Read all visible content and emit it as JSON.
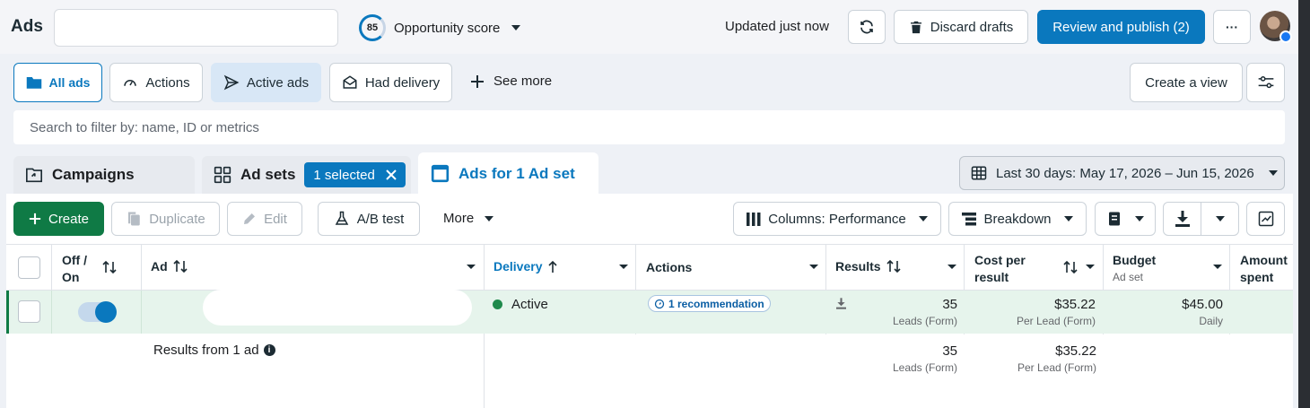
{
  "header": {
    "title": "Ads",
    "search_value": "",
    "score_value": "85",
    "score_label": "Opportunity score",
    "updated_text": "Updated just now",
    "discard_label": "Discard drafts",
    "publish_label": "Review and publish (2)",
    "more_glyph": "···"
  },
  "view_tabs": {
    "all_ads": "All ads",
    "actions": "Actions",
    "active_ads": "Active ads",
    "had_delivery": "Had delivery",
    "see_more": "See more",
    "create_view": "Create a view"
  },
  "filter": {
    "placeholder": "Search to filter by: name, ID or metrics"
  },
  "level_tabs": {
    "campaigns": "Campaigns",
    "ad_sets": "Ad sets",
    "selected_badge": "1 selected",
    "ads_for": "Ads for 1 Ad set"
  },
  "date_range": "Last 30 days: May 17, 2026 – Jun 15, 2026",
  "toolbar": {
    "create": "Create",
    "duplicate": "Duplicate",
    "edit": "Edit",
    "ab_test": "A/B test",
    "more": "More",
    "columns": "Columns: Performance",
    "breakdown": "Breakdown"
  },
  "table": {
    "headers": {
      "offon_1": "Off /",
      "offon_2": "On",
      "ad": "Ad",
      "delivery": "Delivery",
      "actions": "Actions",
      "results": "Results",
      "cost_1": "Cost per",
      "cost_2": "result",
      "budget": "Budget",
      "budget_sub": "Ad set",
      "amount_1": "Amount",
      "amount_2": "spent"
    },
    "row": {
      "delivery": "Active",
      "recommendation": "1 recommendation",
      "results": "35",
      "results_sub": "Leads (Form)",
      "cost": "$35.22",
      "cost_sub": "Per Lead (Form)",
      "budget": "$45.00",
      "budget_sub": "Daily",
      "toggle_on": true
    },
    "summary": {
      "label": "Results from 1 ad",
      "results": "35",
      "results_sub": "Leads (Form)",
      "cost": "$35.22",
      "cost_sub": "Per Lead (Form)"
    }
  },
  "colors": {
    "primary": "#0a78be",
    "create_green": "#0f7a45",
    "active_dot": "#1f8a4c",
    "row_highlight": "#e6f4ec",
    "active_tab_bg": "#d8e7f6"
  },
  "icons": [
    "folder-icon",
    "gauge-icon",
    "send-icon",
    "envelope-icon",
    "plus-icon",
    "sliders-icon",
    "refresh-icon",
    "trash-icon",
    "campaign-icon",
    "grid-icon",
    "close-icon",
    "adset-icon",
    "calendar-grid-icon",
    "copy-icon",
    "pencil-icon",
    "flask-icon",
    "columns-icon",
    "breakdown-icon",
    "report-icon",
    "download-icon",
    "chart-icon",
    "sort-icon",
    "chevron-down-icon",
    "info-icon"
  ]
}
